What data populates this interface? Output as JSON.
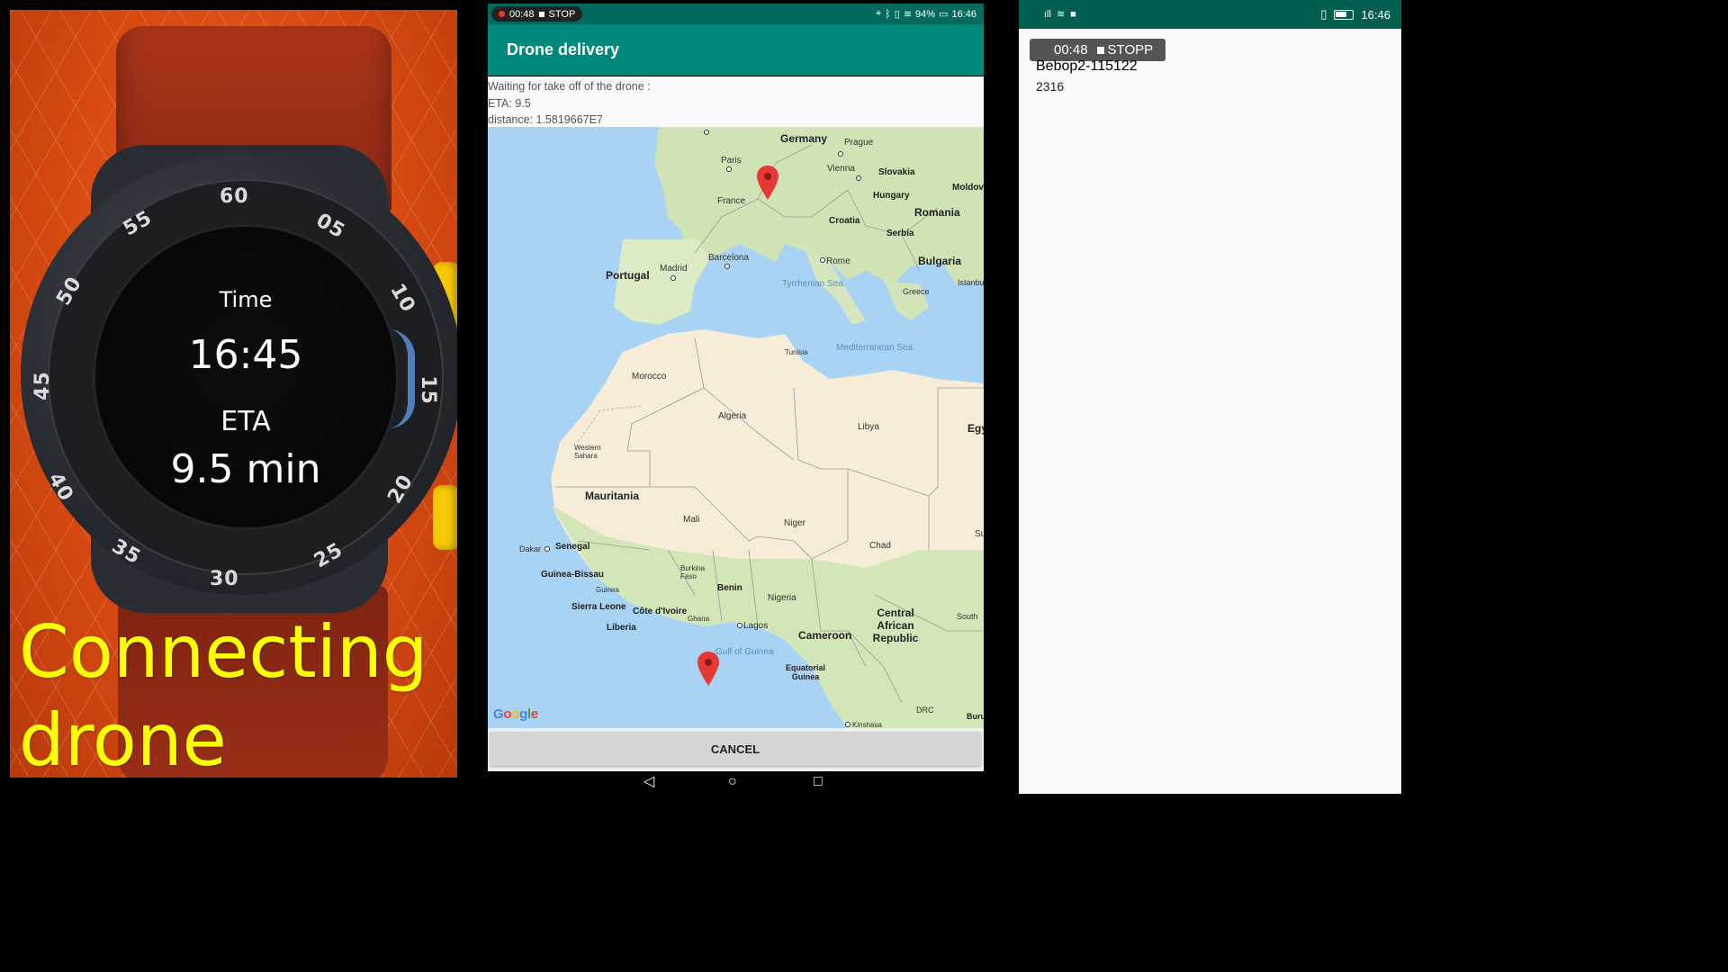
{
  "watch": {
    "bezel_numbers": [
      "60",
      "05",
      "10",
      "15",
      "20",
      "25",
      "30",
      "35",
      "40",
      "45",
      "50",
      "55"
    ],
    "time_label": "Time",
    "time_value": "16:45",
    "eta_label": "ETA",
    "eta_value": "9.5 min",
    "caption_line1": "Connecting",
    "caption_line2": "drone"
  },
  "phone": {
    "status": {
      "rec_time": "00:48",
      "stop_label": "STOP",
      "battery": "94%",
      "clock": "16:46"
    },
    "app_title": "Drone delivery",
    "info": {
      "line1": "Waiting for take off of the drone :",
      "line2": "ETA: 9.5",
      "line3": "distance: 1.5819667E7"
    },
    "map": {
      "labels": {
        "germany": "Germany",
        "prague": "Prague",
        "paris": "Paris",
        "vienna": "Vienna",
        "slovakia": "Slovakia",
        "moldova": "Moldova",
        "hungary": "Hungary",
        "france": "France",
        "romania": "Romania",
        "croatia": "Croatia",
        "serbia": "Serbia",
        "barcelona": "Barcelona",
        "madrid": "Madrid",
        "portugal": "Portugal",
        "rome": "Rome",
        "bulgaria": "Bulgaria",
        "tyrrhenian": "Tyrrhenian Sea",
        "greece": "Greece",
        "istanbul": "Istanbul",
        "tunisia": "Tunisia",
        "med_sea": "Mediterranean Sea",
        "morocco": "Morocco",
        "algeria": "Algeria",
        "libya": "Libya",
        "egypt": "Egy",
        "western_sahara": "Western Sahara",
        "mauritania": "Mauritania",
        "mali": "Mali",
        "niger": "Niger",
        "chad": "Chad",
        "sudan": "Su",
        "dakar": "Dakar",
        "senegal": "Senegal",
        "guinea_bissau": "Guinea-Bissau",
        "guinea": "Guinea",
        "burkina": "Burkina Faso",
        "benin": "Benin",
        "nigeria": "Nigeria",
        "sierra_leone": "Sierra Leone",
        "cote_divoire": "Côte d'Ivoire",
        "ghana": "Ghana",
        "liberia": "Liberia",
        "lagos": "Lagos",
        "car": "Central African Republic",
        "cameroon": "Cameroon",
        "south": "South",
        "gulf_guinea": "Gulf of Guinea",
        "eq_guinea": "Equatorial Guinea",
        "drc": "DRC",
        "kinshasa": "Kinshasa",
        "burundi": "Buru"
      },
      "logo": "Google"
    },
    "cancel_label": "CANCEL"
  },
  "drone_app": {
    "status_clock": "16:46",
    "rec_time": "00:48",
    "stop_label": "STOPP",
    "device_name": "Bebop2-115122",
    "value": "2316"
  }
}
